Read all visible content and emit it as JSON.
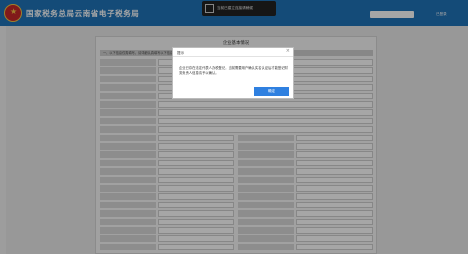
{
  "header": {
    "site_title": "国家税务总局云南省电子税务局",
    "notice_text": "当前已建立连接请稍候",
    "user_text": "已登录"
  },
  "form": {
    "title": "企业基本情况",
    "section_text": "一、以下信息仅需填写，请详细认真填写以下信息"
  },
  "dialog": {
    "title": "提示",
    "close_glyph": "×",
    "message": "企业已存在法定代表人办税登记，当前需要用户确认实名认证后才能登记财务负责人信息请予以确认。",
    "ok_label": "确定"
  },
  "colors": {
    "header_blue": "#1f73b8",
    "button_blue": "#2f80e0"
  }
}
